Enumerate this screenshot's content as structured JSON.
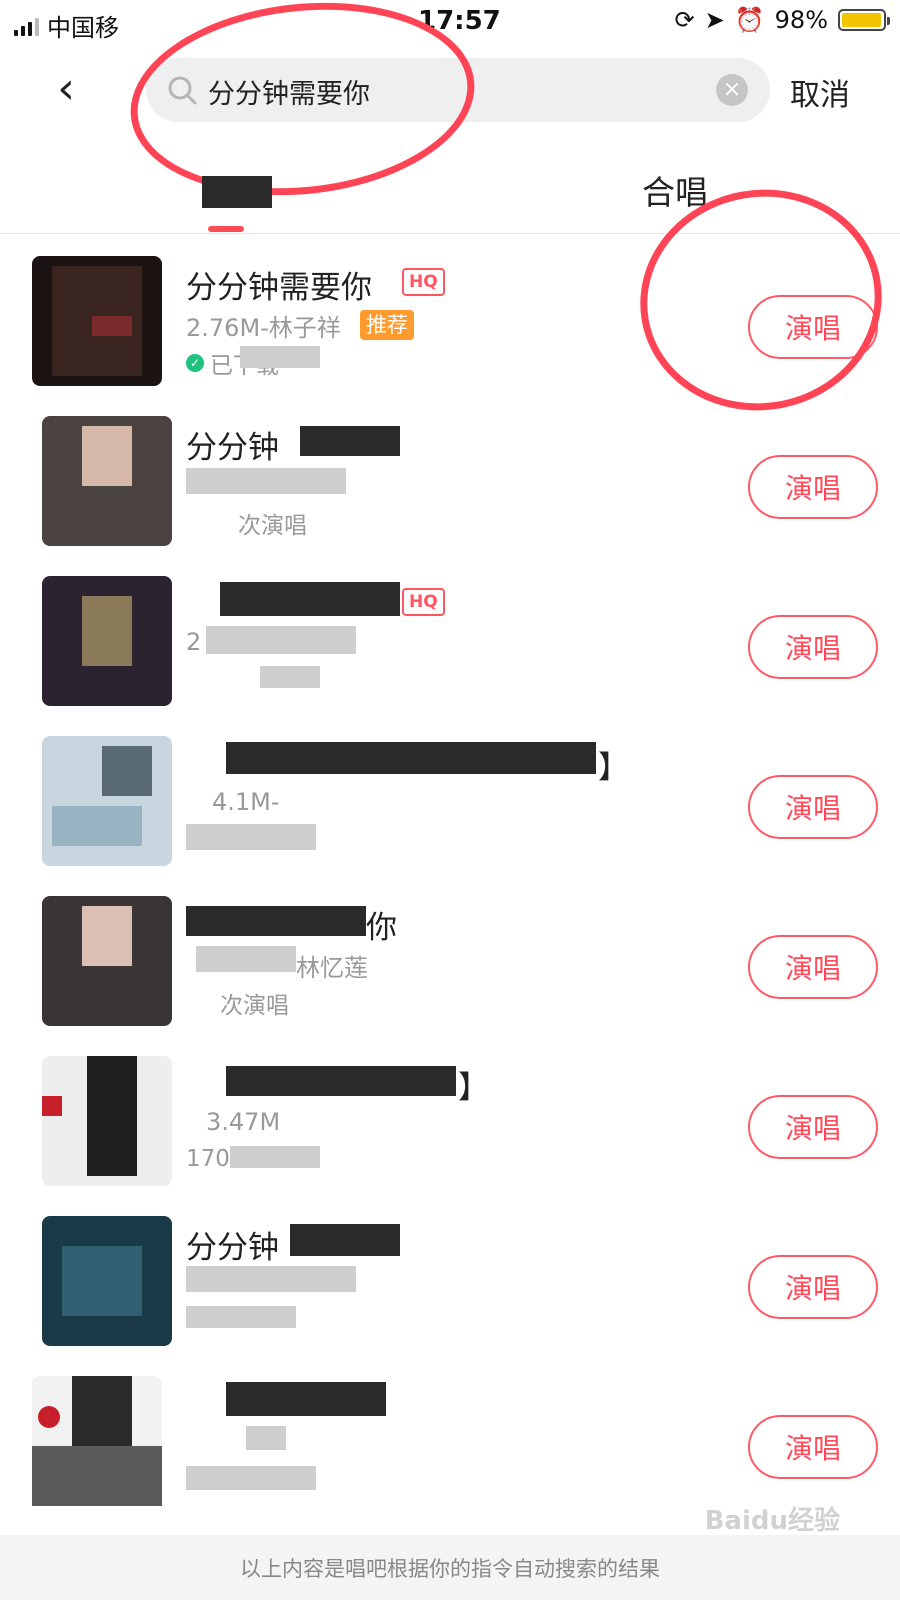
{
  "status_bar": {
    "carrier": "中国移",
    "time": "17:57",
    "battery_percent": "98%",
    "battery_level": 0.98
  },
  "header": {
    "back_icon": "chevron-left-icon",
    "search_icon": "magnifier-icon",
    "search_value": "分分钟需要你",
    "clear_icon": "×",
    "cancel_label": "取消"
  },
  "tabs": [
    {
      "label": "",
      "active": true
    },
    {
      "label": "合唱",
      "active": false
    }
  ],
  "accent_color": "#ff4b57",
  "songs": [
    {
      "title": "分分钟需要你",
      "hq": "HQ",
      "size_artist": "2.76M-林子祥",
      "tag": "推荐",
      "meta": "已下载",
      "action": "演唱"
    },
    {
      "title": "分分钟",
      "hq": "",
      "size_artist": "",
      "tag": "",
      "meta": "次演唱",
      "action": "演唱"
    },
    {
      "title": "",
      "hq": "HQ",
      "size_artist": "2",
      "tag": "",
      "meta": "",
      "action": "演唱"
    },
    {
      "title": "】",
      "hq": "",
      "size_artist": "4.1M-",
      "tag": "",
      "meta": "",
      "action": "演唱"
    },
    {
      "title": "你",
      "hq": "",
      "size_artist": "林忆莲",
      "tag": "",
      "meta": "次演唱",
      "action": "演唱"
    },
    {
      "title": "】",
      "hq": "",
      "size_artist": "3.47M",
      "tag": "",
      "meta": "170",
      "action": "演唱"
    },
    {
      "title": "分分钟",
      "hq": "",
      "size_artist": "",
      "tag": "",
      "meta": "",
      "action": "演唱"
    },
    {
      "title": "",
      "hq": "",
      "size_artist": "",
      "tag": "",
      "meta": "",
      "action": "演唱"
    }
  ],
  "footer": {
    "text": "以上内容是唱吧根据你的指令自动搜索的结果"
  },
  "watermark": "Baidu经验"
}
